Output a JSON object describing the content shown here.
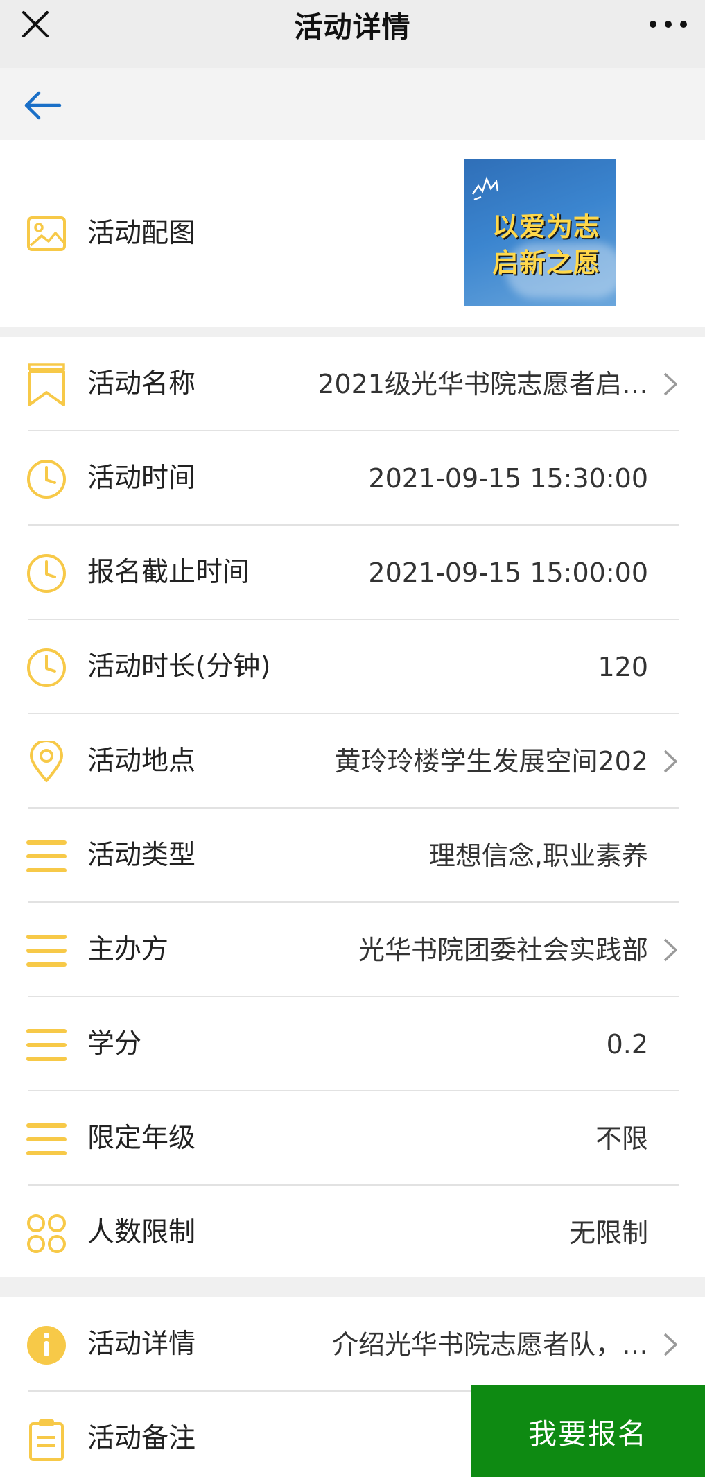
{
  "titlebar": {
    "title": "活动详情",
    "close_icon": "close-icon",
    "more_icon": "more-dots-icon"
  },
  "navbar": {
    "back_icon": "back-arrow-icon"
  },
  "image_row": {
    "label": "活动配图",
    "icon": "image-icon",
    "thumbnail_text_1": "以爱为志",
    "thumbnail_text_2": "启新之愿"
  },
  "rows": [
    {
      "label": "活动名称",
      "value": "2021级光华书院志愿者启…",
      "icon": "bookmark-icon",
      "chevron": true
    },
    {
      "label": "活动时间",
      "value": "2021-09-15 15:30:00",
      "icon": "clock-icon",
      "chevron": false
    },
    {
      "label": "报名截止时间",
      "value": "2021-09-15 15:00:00",
      "icon": "clock-icon",
      "chevron": false
    },
    {
      "label": "活动时长(分钟)",
      "value": "120",
      "icon": "clock-icon",
      "chevron": false
    },
    {
      "label": "活动地点",
      "value": "黄玲玲楼学生发展空间202",
      "icon": "location-pin-icon",
      "chevron": true
    },
    {
      "label": "活动类型",
      "value": "理想信念,职业素养",
      "icon": "list-icon",
      "chevron": false
    },
    {
      "label": "主办方",
      "value": "光华书院团委社会实践部",
      "icon": "list-icon",
      "chevron": true
    },
    {
      "label": "学分",
      "value": "0.2",
      "icon": "list-icon",
      "chevron": false
    },
    {
      "label": "限定年级",
      "value": "不限",
      "icon": "list-icon",
      "chevron": false
    },
    {
      "label": "人数限制",
      "value": "无限制",
      "icon": "grid-icon",
      "chevron": false
    }
  ],
  "detail_rows": [
    {
      "label": "活动详情",
      "value": "介绍光华书院志愿者队，…",
      "icon": "info-icon",
      "chevron": true
    },
    {
      "label": "活动备注",
      "value": "",
      "icon": "clipboard-icon",
      "chevron": false
    }
  ],
  "signup_button": {
    "label": "我要报名"
  },
  "colors": {
    "accent_icon": "#f7c948",
    "signup_green": "#0e8a12",
    "back_blue": "#1a6fc7"
  }
}
